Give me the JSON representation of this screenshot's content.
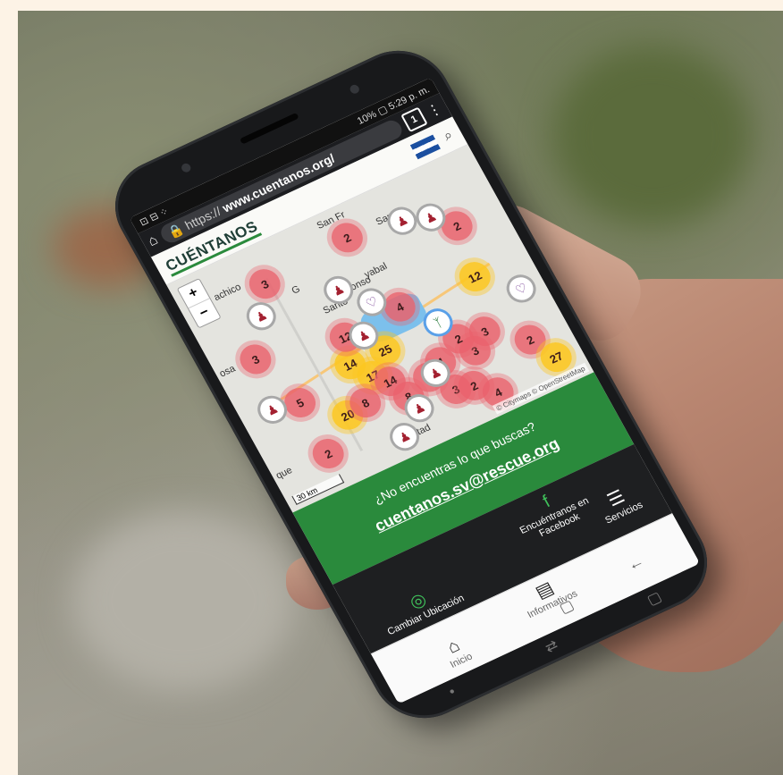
{
  "status_bar": {
    "right": "10% ▢ 5:29 p. m."
  },
  "browser": {
    "url_prefix": "https://",
    "url_domain": "www.cuentanos.org/",
    "tab_count": "1"
  },
  "site": {
    "logo": "CUÉNTANOS"
  },
  "map": {
    "zoom_in": "+",
    "zoom_out": "−",
    "attribution": "© Citymaps © OpenStreetMap",
    "scale": "30 km",
    "places": [
      "achico",
      "San Fr",
      "Santa",
      "yabal",
      "osa",
      "que",
      "bertad",
      "G",
      "Santo",
      "Sonso"
    ],
    "clusters": [
      "3",
      "2",
      "3",
      "4",
      "5",
      "2",
      "14",
      "17",
      "25",
      "20",
      "8",
      "14",
      "8",
      "2",
      "4",
      "2",
      "3",
      "12",
      "2",
      "3",
      "3",
      "2",
      "4",
      "27",
      "12",
      "2"
    ]
  },
  "help_panel": {
    "question": "¿No encuentras lo que buscas?",
    "email": "cuentanos.sv@rescue.org"
  },
  "nav": {
    "facebook": "Encuéntranos en Facebook",
    "location": "Cambiar Ubicación",
    "services": "Servicios",
    "informatives": "Informativos",
    "home": "Inicio"
  },
  "icons": [
    "home-icon",
    "lock-icon",
    "search-icon",
    "location-icon",
    "facebook-icon",
    "list-icon",
    "document-icon",
    "back-icon",
    "recent-apps-icon"
  ]
}
